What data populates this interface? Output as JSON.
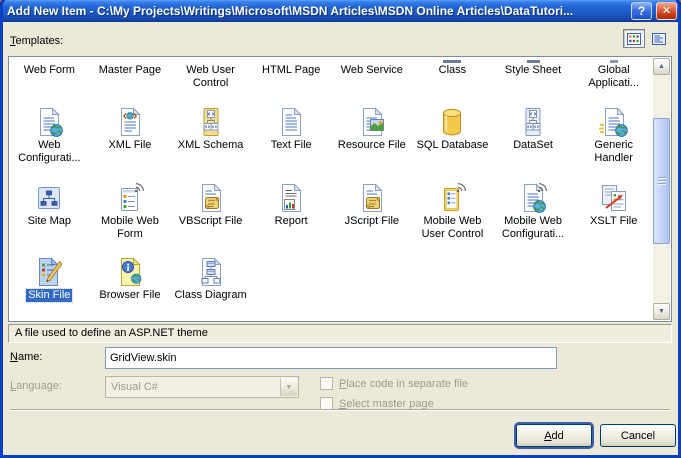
{
  "window": {
    "title": "Add New Item - C:\\My Projects\\Writings\\Microsoft\\MSDN Articles\\MSDN Online Articles\\DataTutori...",
    "help_glyph": "?",
    "close_glyph": "✕"
  },
  "templates": {
    "label": "Templates:",
    "view_buttons": {
      "icons_view": "large-icons-view",
      "report_view": "report-view"
    },
    "rows": [
      {
        "items": [
          {
            "label": "Web Form"
          },
          {
            "label": "Master Page"
          },
          {
            "label": "Web User Control"
          },
          {
            "label": "HTML Page"
          },
          {
            "label": "Web Service"
          },
          {
            "label": "Class"
          },
          {
            "label": "Style Sheet"
          },
          {
            "label": "Global Applicati..."
          }
        ]
      },
      {
        "items": [
          {
            "label": "Web Configurati...",
            "icon": "doc-globe"
          },
          {
            "label": "XML File",
            "icon": "doc-xml"
          },
          {
            "label": "XML Schema",
            "icon": "xml-schema"
          },
          {
            "label": "Text File",
            "icon": "doc-plain"
          },
          {
            "label": "Resource File",
            "icon": "doc-image"
          },
          {
            "label": "SQL Database",
            "icon": "database"
          },
          {
            "label": "DataSet",
            "icon": "dataset"
          },
          {
            "label": "Generic Handler",
            "icon": "doc-globe-fast"
          }
        ]
      },
      {
        "items": [
          {
            "label": "Site Map",
            "icon": "sitemap"
          },
          {
            "label": "Mobile Web Form",
            "icon": "mobile-form"
          },
          {
            "label": "VBScript File",
            "icon": "script"
          },
          {
            "label": "Report",
            "icon": "report"
          },
          {
            "label": "JScript File",
            "icon": "script"
          },
          {
            "label": "Mobile Web User Control",
            "icon": "mobile-panel"
          },
          {
            "label": "Mobile Web Configurati...",
            "icon": "doc-globe-signal"
          },
          {
            "label": "XSLT File",
            "icon": "xslt"
          }
        ]
      },
      {
        "items": [
          {
            "label": "Skin File",
            "icon": "skin",
            "selected": true
          },
          {
            "label": "Browser File",
            "icon": "browser"
          },
          {
            "label": "Class Diagram",
            "icon": "class-diagram"
          }
        ]
      }
    ],
    "selected_item": "Skin File",
    "description": "A file used to define an ASP.NET theme"
  },
  "form": {
    "name_label": "Name:",
    "name_value": "GridView.skin",
    "language_label": "Language:",
    "language_value": "Visual C#",
    "checkbox_separate_file": "Place code in separate file",
    "checkbox_master_page": "Select master page"
  },
  "buttons": {
    "add": "Add",
    "cancel": "Cancel"
  },
  "colors": {
    "titlebar": "#1C59C6",
    "selection": "#316AC5",
    "face": "#ECE9D8",
    "window_border": "#0C3FC4"
  }
}
